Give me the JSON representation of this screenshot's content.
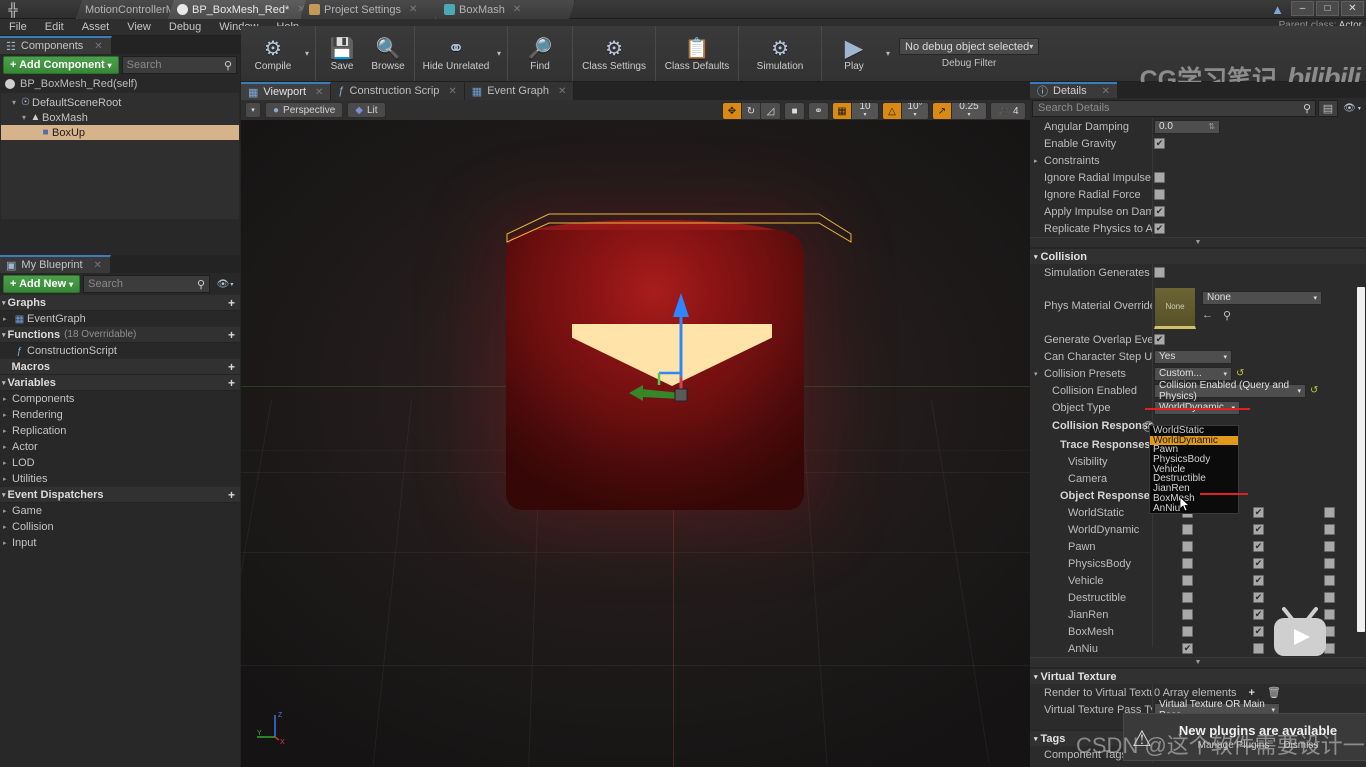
{
  "window": {
    "tabs": [
      {
        "label": "MotionControllerMap",
        "icon": "map-icon",
        "active": false,
        "color": "#7d7d7d"
      },
      {
        "label": "BP_BoxMesh_Red*",
        "icon": "blueprint-icon",
        "active": true,
        "color": "#dcdcdc"
      },
      {
        "label": "Project Settings",
        "icon": "settings-icon",
        "active": false,
        "color": "#c39a55"
      },
      {
        "label": "BoxMash",
        "icon": "mesh-icon",
        "active": false,
        "color": "#49a9b5"
      }
    ],
    "controls": {
      "minimize": "–",
      "maximize": "□",
      "close": "✕"
    },
    "parent_class_label": "Parent class:",
    "parent_class_value": "Actor"
  },
  "menubar": [
    "File",
    "Edit",
    "Asset",
    "View",
    "Debug",
    "Window",
    "Help"
  ],
  "toolbar": {
    "items": [
      {
        "label": "Compile",
        "icon": "compile-icon",
        "glyph": "⚙",
        "has_arrow": true
      },
      {
        "label": "Save",
        "icon": "save-icon",
        "glyph": "💾",
        "has_arrow": false
      },
      {
        "label": "Browse",
        "icon": "browse-icon",
        "glyph": "🔍",
        "has_arrow": false
      },
      {
        "label": "Hide Unrelated",
        "icon": "hide-unrelated-icon",
        "glyph": "⚷",
        "has_arrow": true
      },
      {
        "label": "Find",
        "icon": "find-icon",
        "glyph": "🔭",
        "has_arrow": false
      },
      {
        "label": "Class Settings",
        "icon": "class-settings-icon",
        "glyph": "⚙",
        "has_arrow": false
      },
      {
        "label": "Class Defaults",
        "icon": "class-defaults-icon",
        "glyph": "🗒",
        "has_arrow": false
      },
      {
        "label": "Simulation",
        "icon": "simulation-icon",
        "glyph": "▶",
        "has_arrow": false
      },
      {
        "label": "Play",
        "icon": "play-icon",
        "glyph": "▶",
        "has_arrow": true
      }
    ],
    "debug_object": "No debug object selected",
    "debug_filter_label": "Debug Filter"
  },
  "watermark": {
    "top_text": "CG学习笔记",
    "top_brand": "bilibili",
    "bottom_text": "CSDN @这个软件需要设计一下"
  },
  "components_panel": {
    "tab_label": "Components",
    "add_component_label": "+ Add Component",
    "add_component_caret": "▾",
    "search_placeholder": "Search",
    "self_row": "BP_BoxMesh_Red(self)",
    "tree": [
      {
        "label": "DefaultSceneRoot",
        "indent": 0,
        "icon": "scene-root-icon",
        "selected": false
      },
      {
        "label": "BoxMash",
        "indent": 1,
        "icon": "static-mesh-icon",
        "selected": false
      },
      {
        "label": "BoxUp",
        "indent": 2,
        "icon": "cube-icon",
        "selected": true
      }
    ]
  },
  "myblueprint_panel": {
    "tab_label": "My Blueprint",
    "add_new_label": "+ Add New",
    "add_new_caret": "▾",
    "search_placeholder": "Search",
    "sections": [
      {
        "type": "group",
        "label": "Graphs",
        "plus": true
      },
      {
        "type": "item",
        "label": "EventGraph",
        "icon": "graph-icon",
        "expandable": true
      },
      {
        "type": "group",
        "label": "Functions",
        "sub": "(18 Overridable)",
        "plus": true
      },
      {
        "type": "item",
        "label": "ConstructionScript",
        "icon": "function-icon",
        "expandable": false
      },
      {
        "type": "group",
        "label": "Macros",
        "plus": true,
        "no_tri": true
      },
      {
        "type": "group",
        "label": "Variables",
        "plus": true
      },
      {
        "type": "item",
        "label": "Components",
        "expandable": true
      },
      {
        "type": "item",
        "label": "Rendering",
        "expandable": true
      },
      {
        "type": "item",
        "label": "Replication",
        "expandable": true
      },
      {
        "type": "item",
        "label": "Actor",
        "expandable": true
      },
      {
        "type": "item",
        "label": "LOD",
        "expandable": true
      },
      {
        "type": "item",
        "label": "Utilities",
        "expandable": true
      },
      {
        "type": "group",
        "label": "Event Dispatchers",
        "plus": true
      },
      {
        "type": "item",
        "label": "Game",
        "expandable": true
      },
      {
        "type": "item",
        "label": "Collision",
        "expandable": true
      },
      {
        "type": "item",
        "label": "Input",
        "expandable": true
      }
    ]
  },
  "viewport": {
    "tabs": [
      {
        "label": "Viewport",
        "icon": "viewport-icon",
        "active": true
      },
      {
        "label": "Construction Scrip",
        "icon": "function-icon",
        "active": false
      },
      {
        "label": "Event Graph",
        "icon": "graph-icon",
        "active": false
      }
    ],
    "perspective_label": "Perspective",
    "lit_label": "Lit",
    "snap": {
      "grid_value": "10",
      "rotation_value": "10°",
      "scale_value": "0.25",
      "camera_speed": "4"
    },
    "axis_labels": {
      "x": "X",
      "y": "Y",
      "z": "Z"
    }
  },
  "details_panel": {
    "tab_label": "Details",
    "search_placeholder": "Search Details",
    "physics_rows": [
      {
        "label": "Angular Damping",
        "type": "number",
        "value": "0.0"
      },
      {
        "label": "Enable Gravity",
        "type": "check",
        "checked": true
      },
      {
        "label": "Constraints",
        "type": "expand"
      },
      {
        "label": "Ignore Radial Impulse",
        "type": "check",
        "checked": false
      },
      {
        "label": "Ignore Radial Force",
        "type": "check",
        "checked": false
      },
      {
        "label": "Apply Impulse on Damage",
        "type": "check",
        "checked": true
      },
      {
        "label": "Replicate Physics to Autono",
        "type": "check",
        "checked": true
      }
    ],
    "collision_category": "Collision",
    "sim_hit_label": "Simulation Generates Hit Ev",
    "sim_hit_checked": false,
    "phys_material_label": "Phys Material Override",
    "phys_material_swatch": "None",
    "phys_material_value": "None",
    "generate_overlap_label": "Generate Overlap Events",
    "generate_overlap_checked": true,
    "can_step_up_label": "Can Character Step Up On",
    "can_step_up_value": "Yes",
    "collision_presets_label": "Collision Presets",
    "collision_presets_value": "Custom...",
    "collision_enabled_label": "Collision Enabled",
    "collision_enabled_value": "Collision Enabled (Query and Physics)",
    "object_type_label": "Object Type",
    "object_type_value": "WorldDynamic",
    "object_type_options": [
      "WorldStatic",
      "WorldDynamic",
      "Pawn",
      "PhysicsBody",
      "Vehicle",
      "Destructible",
      "JianRen",
      "BoxMesh",
      "AnNiu"
    ],
    "object_type_selected": "WorldDynamic",
    "collision_responses_label": "Collision Responses",
    "trace_responses_label": "Trace Responses",
    "trace_rows": [
      "Visibility",
      "Camera"
    ],
    "object_responses_label": "Object Responses",
    "object_rows": [
      {
        "label": "WorldStatic",
        "ignore": false,
        "overlap": true,
        "block": false
      },
      {
        "label": "WorldDynamic",
        "ignore": false,
        "overlap": true,
        "block": false
      },
      {
        "label": "Pawn",
        "ignore": false,
        "overlap": true,
        "block": false
      },
      {
        "label": "PhysicsBody",
        "ignore": false,
        "overlap": true,
        "block": false
      },
      {
        "label": "Vehicle",
        "ignore": false,
        "overlap": true,
        "block": false
      },
      {
        "label": "Destructible",
        "ignore": false,
        "overlap": true,
        "block": false
      },
      {
        "label": "JianRen",
        "ignore": false,
        "overlap": true,
        "block": false
      },
      {
        "label": "BoxMesh",
        "ignore": false,
        "overlap": true,
        "block": false
      },
      {
        "label": "AnNiu",
        "ignore": true,
        "overlap": false,
        "block": false
      }
    ],
    "virtual_texture_category": "Virtual Texture",
    "render_vt_label": "Render to Virtual Textures",
    "render_vt_value": "0 Array elements",
    "vt_pass_label": "Virtual Texture Pass Type",
    "vt_pass_value": "Virtual Texture OR Main Pass",
    "tags_category": "Tags",
    "component_tags_label": "Component Tags"
  },
  "toast": {
    "title": "New plugins are available",
    "manage_label": "Manage Plugins",
    "dismiss_label": "Dismiss"
  },
  "colors": {
    "accent_orange": "#d98a13",
    "selection_tan": "#d6b38a",
    "tab_top_blue": "#3d7cbb",
    "annotation_red": "#e32020",
    "green_button": "#4ca04c"
  }
}
